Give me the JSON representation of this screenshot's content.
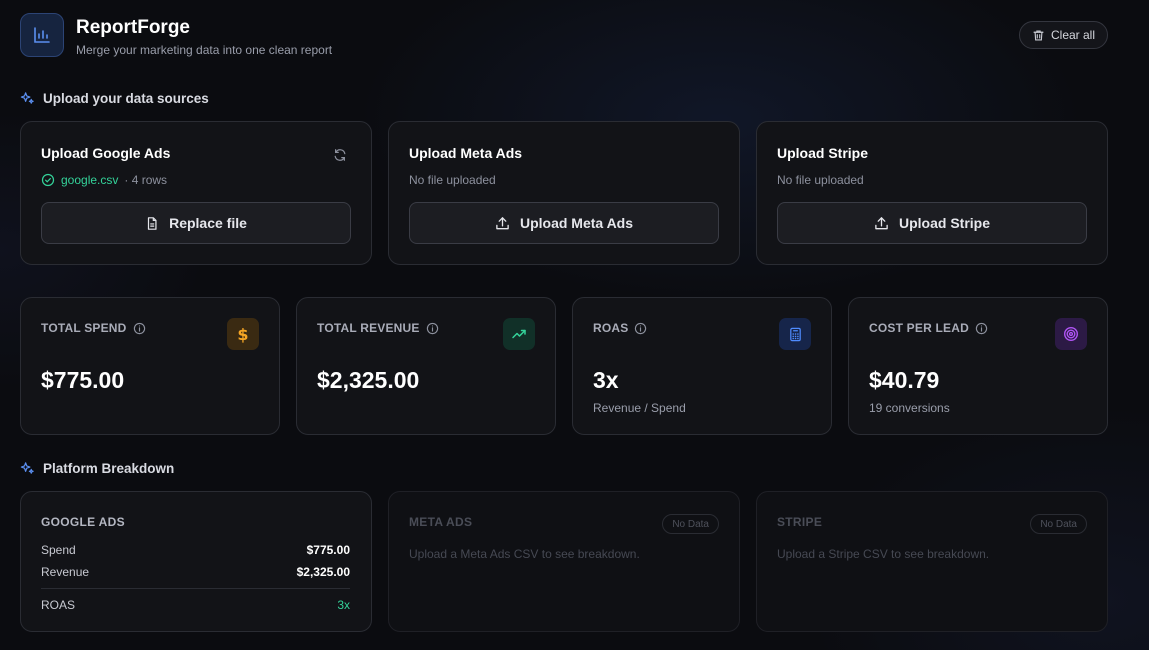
{
  "header": {
    "title": "ReportForge",
    "subtitle": "Merge your marketing data into one clean report",
    "clear_label": "Clear all",
    "logo_icon": "bar-chart-icon"
  },
  "upload_section": {
    "heading": "Upload your data sources",
    "cards": [
      {
        "title": "Upload Google Ads",
        "file": "google.csv",
        "rows": "· 4 rows",
        "button": "Replace file",
        "button_icon": "file-icon",
        "action_icon": "refresh-icon"
      },
      {
        "title": "Upload Meta Ads",
        "status": "No file uploaded",
        "button": "Upload Meta Ads",
        "button_icon": "upload-icon"
      },
      {
        "title": "Upload Stripe",
        "status": "No file uploaded",
        "button": "Upload Stripe",
        "button_icon": "upload-icon"
      }
    ]
  },
  "stats": [
    {
      "label": "TOTAL SPEND",
      "value": "$775.00",
      "sub": "",
      "icon": "dollar-icon",
      "color": "#f5a524"
    },
    {
      "label": "TOTAL REVENUE",
      "value": "$2,325.00",
      "sub": "",
      "icon": "trending-up-icon",
      "color": "#34d39a"
    },
    {
      "label": "ROAS",
      "value": "3x",
      "sub": "Revenue / Spend",
      "icon": "calculator-icon",
      "color": "#4f8cff"
    },
    {
      "label": "COST PER LEAD",
      "value": "$40.79",
      "sub": "19 conversions",
      "icon": "target-icon",
      "color": "#b054f5"
    }
  ],
  "breakdown": {
    "heading": "Platform Breakdown",
    "google": {
      "title": "GOOGLE ADS",
      "spend_label": "Spend",
      "spend": "$775.00",
      "revenue_label": "Revenue",
      "revenue": "$2,325.00",
      "roas_label": "ROAS",
      "roas": "3x"
    },
    "meta": {
      "title": "META ADS",
      "badge": "No Data",
      "message": "Upload a Meta Ads CSV to see breakdown."
    },
    "stripe": {
      "title": "STRIPE",
      "badge": "No Data",
      "message": "Upload a Stripe CSV to see breakdown."
    }
  }
}
